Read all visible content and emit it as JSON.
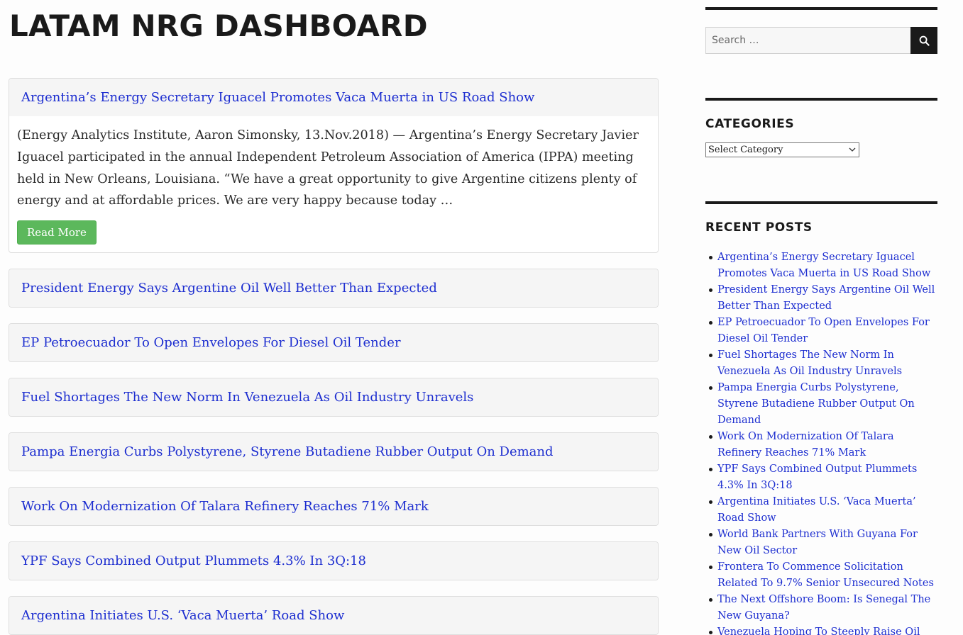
{
  "site": {
    "title": "LATAM NRG DASHBOARD"
  },
  "posts": [
    {
      "title": "Argentina’s Energy Secretary Iguacel Promotes Vaca Muerta in US Road Show",
      "excerpt": "(Energy Analytics Institute, Aaron Simonsky, 13.Nov.2018) — Argentina’s Energy Secretary Javier Iguacel participated in the annual Independent Petroleum Association of America (IPPA) meeting held in New Orleans, Louisiana. “We have a great opportunity to give Argentine citizens plenty of energy and at affordable prices. We are very happy because today …",
      "read_more": "Read More"
    },
    {
      "title": "President Energy Says Argentine Oil Well Better Than Expected"
    },
    {
      "title": "EP Petroecuador To Open Envelopes For Diesel Oil Tender"
    },
    {
      "title": "Fuel Shortages The New Norm In Venezuela As Oil Industry Unravels"
    },
    {
      "title": "Pampa Energia Curbs Polystyrene, Styrene Butadiene Rubber Output On Demand"
    },
    {
      "title": "Work On Modernization Of Talara Refinery Reaches 71% Mark"
    },
    {
      "title": "YPF Says Combined Output Plummets 4.3% In 3Q:18"
    },
    {
      "title": "Argentina Initiates U.S. ‘Vaca Muerta’ Road Show"
    }
  ],
  "sidebar": {
    "search": {
      "placeholder": "Search …",
      "icon": "search-icon"
    },
    "categories": {
      "title": "CATEGORIES",
      "selected": "Select Category"
    },
    "recent": {
      "title": "RECENT POSTS",
      "items": [
        "Argentina’s Energy Secretary Iguacel Promotes Vaca Muerta in US Road Show",
        "President Energy Says Argentine Oil Well Better Than Expected",
        "EP Petroecuador To Open Envelopes For Diesel Oil Tender",
        "Fuel Shortages The New Norm In Venezuela As Oil Industry Unravels",
        "Pampa Energia Curbs Polystyrene, Styrene Butadiene Rubber Output On Demand",
        "Work On Modernization Of Talara Refinery Reaches 71% Mark",
        "YPF Says Combined Output Plummets 4.3% In 3Q:18",
        "Argentina Initiates U.S. ‘Vaca Muerta’ Road Show",
        "World Bank Partners With Guyana For New Oil Sector",
        "Frontera To Commence Solicitation Related To 9.7% Senior Unsecured Notes",
        "The Next Offshore Boom: Is Senegal The New Guyana?",
        "Venezuela Hoping To Steeply Raise Oil"
      ]
    }
  },
  "colors": {
    "link": "#1d2ed0",
    "button": "#5cb85c",
    "rule": "#1a1a1a"
  }
}
